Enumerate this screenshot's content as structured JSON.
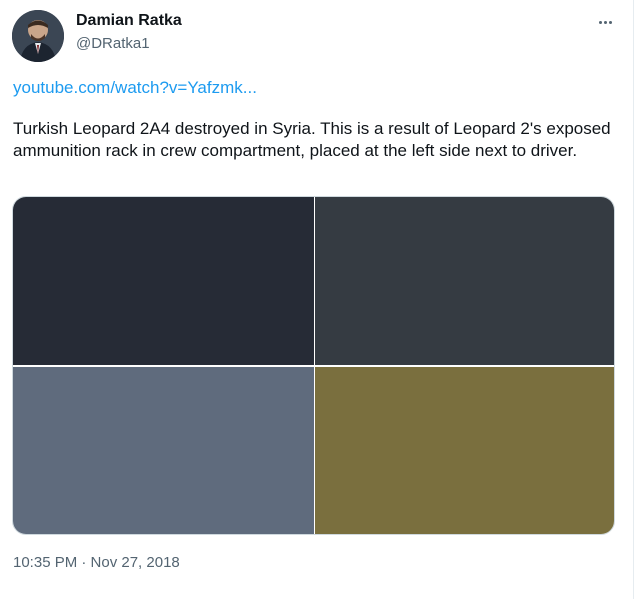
{
  "author": {
    "name": "Damian Ratka",
    "handle": "@DRatka1"
  },
  "tweet": {
    "link_text": "youtube.com/watch?v=Yafzmk...",
    "text": "Turkish Leopard 2A4 destroyed in Syria. This is a result of Leopard 2's exposed ammunition rack in crew compartment, placed at the left side next to driver.",
    "timestamp": "10:35 PM · Nov 27, 2018"
  },
  "media": {
    "photos": [
      {
        "color": "#262b36"
      },
      {
        "color": "#353b42"
      },
      {
        "color": "#5f6b7d"
      },
      {
        "color": "#7a6f3e"
      }
    ]
  },
  "icons": {
    "more": "more-horizontal-icon",
    "avatar": "avatar"
  },
  "colors": {
    "link": "#1d9bf0",
    "secondary_text": "#536471",
    "primary_text": "#0f1419"
  }
}
